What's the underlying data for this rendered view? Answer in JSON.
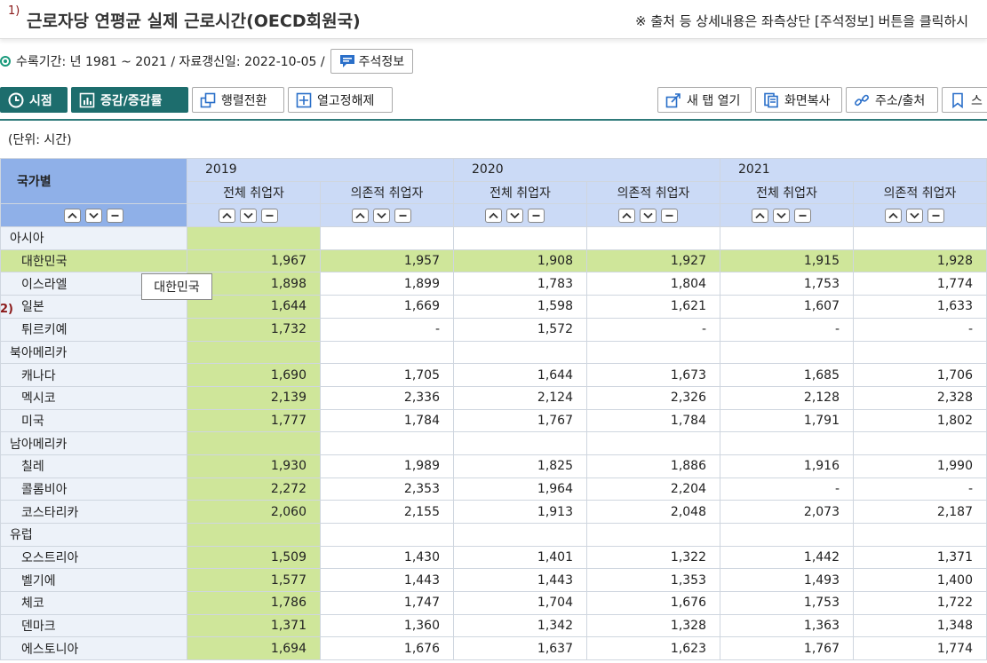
{
  "title": {
    "num": "1)",
    "text": "근로자당 연평균 실제 근로시간(OECD회원국)",
    "note": "※ 출처 등 상세내용은 좌측상단 [주석정보] 버튼을 클릭하시"
  },
  "period": {
    "text": "수록기간: 년 1981 ~ 2021 / 자료갱신일: 2022-10-05 /",
    "memo_label": "주석정보"
  },
  "toolbar": {
    "timepoint": "시점",
    "change": "증감/증감률",
    "pivot": "행렬전환",
    "freeze": "열고정해제",
    "new_tab": "새 탭 열기",
    "screen_copy": "화면복사",
    "url_source": "주소/출처",
    "bookmark": "스"
  },
  "unit": "(단위: 시간)",
  "table": {
    "corner_label": "국가별",
    "years": [
      "2019",
      "2020",
      "2021"
    ],
    "sub_headers": [
      "전체 취업자",
      "의존적 취업자"
    ],
    "rows": [
      {
        "label": "아시아",
        "type": "group",
        "values": [
          "",
          "",
          "",
          "",
          "",
          ""
        ]
      },
      {
        "label": "대한민국",
        "type": "item",
        "selected": true,
        "values": [
          "1,967",
          "1,957",
          "1,908",
          "1,927",
          "1,915",
          "1,928"
        ]
      },
      {
        "label": "이스라엘",
        "type": "item",
        "values": [
          "1,898",
          "1,899",
          "1,783",
          "1,804",
          "1,753",
          "1,774"
        ]
      },
      {
        "label": "일본",
        "type": "item",
        "values": [
          "1,644",
          "1,669",
          "1,598",
          "1,621",
          "1,607",
          "1,633"
        ]
      },
      {
        "label": "튀르키예",
        "type": "item",
        "values": [
          "1,732",
          "-",
          "1,572",
          "-",
          "-",
          "-"
        ]
      },
      {
        "label": "북아메리카",
        "type": "group",
        "values": [
          "",
          "",
          "",
          "",
          "",
          ""
        ]
      },
      {
        "label": "캐나다",
        "type": "item",
        "values": [
          "1,690",
          "1,705",
          "1,644",
          "1,673",
          "1,685",
          "1,706"
        ]
      },
      {
        "label": "멕시코",
        "type": "item",
        "values": [
          "2,139",
          "2,336",
          "2,124",
          "2,326",
          "2,128",
          "2,328"
        ]
      },
      {
        "label": "미국",
        "type": "item",
        "values": [
          "1,777",
          "1,784",
          "1,767",
          "1,784",
          "1,791",
          "1,802"
        ]
      },
      {
        "label": "남아메리카",
        "type": "group",
        "values": [
          "",
          "",
          "",
          "",
          "",
          ""
        ]
      },
      {
        "label": "칠레",
        "type": "item",
        "values": [
          "1,930",
          "1,989",
          "1,825",
          "1,886",
          "1,916",
          "1,990"
        ]
      },
      {
        "label": "콜롬비아",
        "type": "item",
        "values": [
          "2,272",
          "2,353",
          "1,964",
          "2,204",
          "-",
          "-"
        ]
      },
      {
        "label": "코스타리카",
        "type": "item",
        "values": [
          "2,060",
          "2,155",
          "1,913",
          "2,048",
          "2,073",
          "2,187"
        ]
      },
      {
        "label": "유럽",
        "type": "group",
        "values": [
          "",
          "",
          "",
          "",
          "",
          ""
        ]
      },
      {
        "label": "오스트리아",
        "type": "item",
        "values": [
          "1,509",
          "1,430",
          "1,401",
          "1,322",
          "1,442",
          "1,371"
        ]
      },
      {
        "label": "벨기에",
        "type": "item",
        "values": [
          "1,577",
          "1,443",
          "1,443",
          "1,353",
          "1,493",
          "1,400"
        ]
      },
      {
        "label": "체코",
        "type": "item",
        "values": [
          "1,786",
          "1,747",
          "1,704",
          "1,676",
          "1,753",
          "1,722"
        ]
      },
      {
        "label": "덴마크",
        "type": "item",
        "values": [
          "1,371",
          "1,360",
          "1,342",
          "1,328",
          "1,363",
          "1,348"
        ]
      },
      {
        "label": "에스토니아",
        "type": "item",
        "values": [
          "1,694",
          "1,676",
          "1,637",
          "1,623",
          "1,767",
          "1,774"
        ]
      }
    ]
  },
  "tooltip": "대한민국",
  "row_note": "2)",
  "colors": {
    "accent": "#1d6d6d",
    "header": "#cbdaf6",
    "corner": "#8fb0e8",
    "highlight": "#cfe69a",
    "label_bg": "#edf2f9"
  }
}
